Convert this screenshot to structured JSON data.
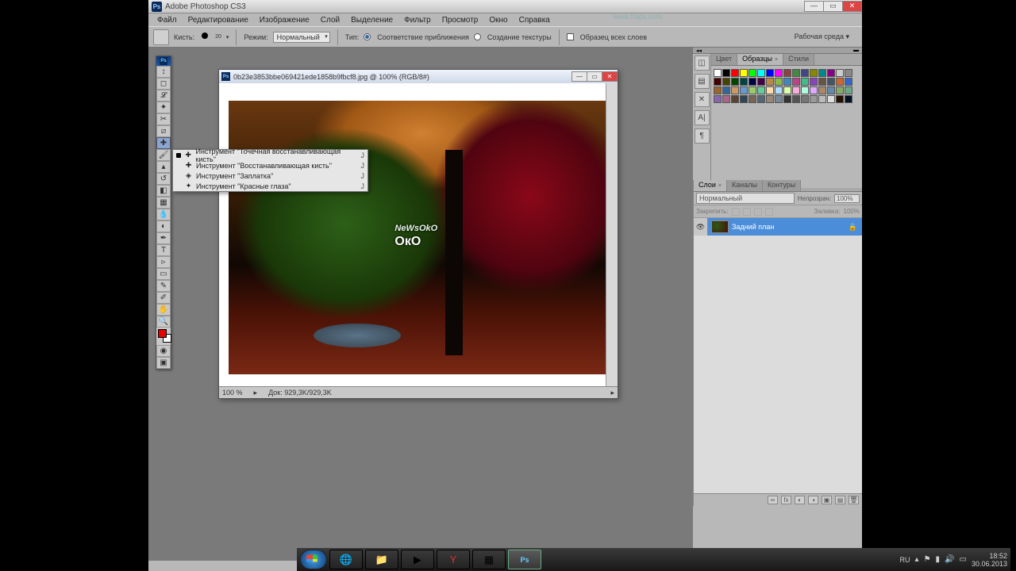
{
  "app": {
    "title": "Adobe Photoshop CS3"
  },
  "menu": [
    "Файл",
    "Редактирование",
    "Изображение",
    "Слой",
    "Выделение",
    "Фильтр",
    "Просмотр",
    "Окно",
    "Справка"
  ],
  "optbar": {
    "brush_label": "Кисть:",
    "brush_size": "20",
    "mode_label": "Режим:",
    "mode_value": "Нормальный",
    "type_label": "Тип:",
    "r1": "Соответствие приближения",
    "r2": "Создание текстуры",
    "chk": "Образец всех слоев",
    "workspace": "Рабочая среда"
  },
  "doc": {
    "title": "0b23e3853bbe069421ede1858b9fbcf8.jpg @ 100% (RGB/8#)",
    "zoom": "100 %",
    "docinfo": "Док: 929,3K/929,3K",
    "wm1": "NeWsOkO",
    "wm2": "ОкО"
  },
  "flyout": [
    {
      "sel": true,
      "t": "Инструмент \"Точечная восстанавливающая кисть\"",
      "k": "J"
    },
    {
      "sel": false,
      "t": "Инструмент \"Восстанавливающая кисть\"",
      "k": "J"
    },
    {
      "sel": false,
      "t": "Инструмент \"Заплатка\"",
      "k": "J"
    },
    {
      "sel": false,
      "t": "Инструмент \"Красные глаза\"",
      "k": "J"
    }
  ],
  "color_tabs": [
    "Цвет",
    "Образцы",
    "Стили"
  ],
  "swatch_colors": [
    "#fff",
    "#000",
    "#f00",
    "#ff0",
    "#0f0",
    "#0ff",
    "#00f",
    "#f0f",
    "#844",
    "#484",
    "#448",
    "#880",
    "#088",
    "#808",
    "#ccc",
    "#888",
    "#400",
    "#440",
    "#040",
    "#044",
    "#004",
    "#404",
    "#b84",
    "#8b4",
    "#48b",
    "#b48",
    "#4b8",
    "#84b",
    "#654",
    "#456",
    "#c63",
    "#36c",
    "#963",
    "#369",
    "#c96",
    "#69c",
    "#9c6",
    "#6c9",
    "#fda",
    "#adf",
    "#dfa",
    "#fad",
    "#afd",
    "#daf",
    "#a86",
    "#68a",
    "#8a6",
    "#6a8",
    "#86a",
    "#a68",
    "#543",
    "#345",
    "#765",
    "#567",
    "#987",
    "#789",
    "#333",
    "#555",
    "#777",
    "#999",
    "#bbb",
    "#ddd",
    "#210",
    "#012"
  ],
  "layer_tabs": [
    "Слои",
    "Каналы",
    "Контуры"
  ],
  "layers": {
    "blend": "Нормальный",
    "opacity_label": "Непрозрач:",
    "opacity": "100%",
    "lock_label": "Закрепить:",
    "fill_label": "Заливка:",
    "fill": "100%",
    "bg_layer": "Задний план"
  },
  "tray": {
    "lang": "RU",
    "time": "18:52",
    "date": "30.06.2013"
  },
  "fraps": "www.fraps.com"
}
